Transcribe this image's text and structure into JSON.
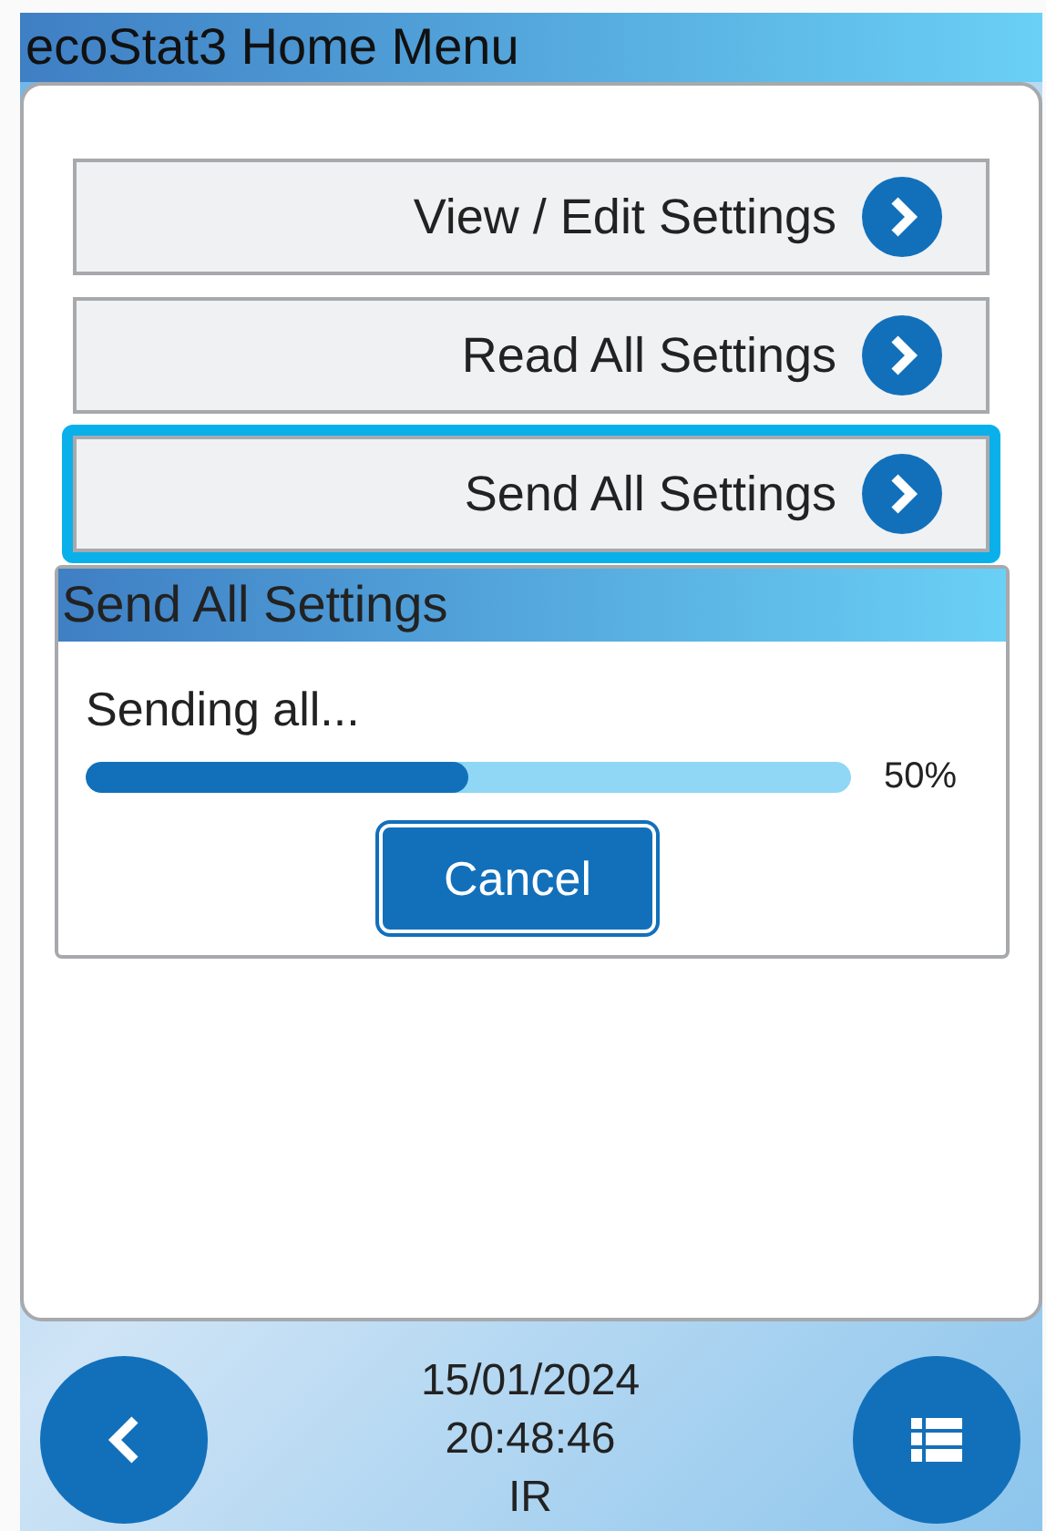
{
  "window": {
    "title": "ecoStat3 Home Menu"
  },
  "menu": [
    {
      "label": "View / Edit Settings",
      "selected": false
    },
    {
      "label": "Read All Settings",
      "selected": false
    },
    {
      "label": "Send All Settings",
      "selected": true
    }
  ],
  "dialog": {
    "title": "Send All Settings",
    "message": "Sending all...",
    "progress": {
      "level": 0.5,
      "reading": "50%"
    },
    "button": "Cancel"
  },
  "status_bar": {
    "date": "15/01/2024",
    "time": "20:48:46",
    "mode": "IR"
  }
}
